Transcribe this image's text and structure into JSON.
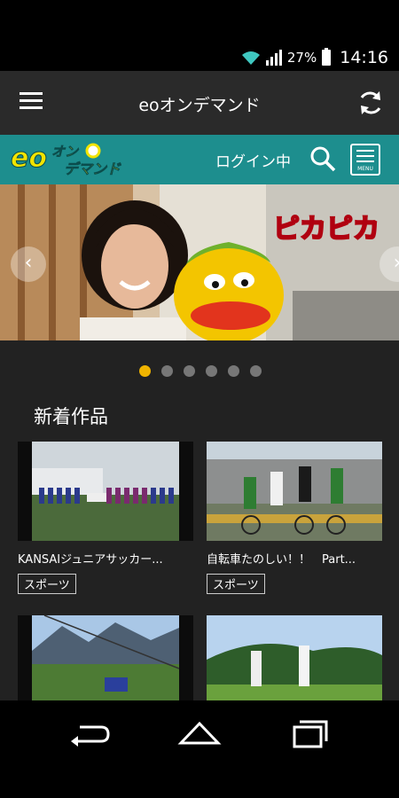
{
  "status_bar": {
    "battery": "27%",
    "time": "14:16",
    "icons": [
      "wifi-icon",
      "signal-icon",
      "battery-icon"
    ]
  },
  "action_bar": {
    "title": "eoオンデマンド",
    "icons": [
      "hamburger-menu-icon",
      "refresh-icon"
    ]
  },
  "brand_bar": {
    "logo_text": "eo",
    "logo_sub": "オン デマンド",
    "login_status": "ログイン中",
    "menu_label": "MENU",
    "accent_color": "#1d8e8e"
  },
  "hero": {
    "banner_text": "ピカピカ",
    "slides_total": 6,
    "active_slide": 1,
    "active_dot_color": "#f0b400"
  },
  "new_works": {
    "heading": "新着作品",
    "items": [
      {
        "title": "KANSAIジュニアサッカー...",
        "tag": "スポーツ"
      },
      {
        "title": "自転車たのしい！！　Part...",
        "tag": "スポーツ"
      },
      {
        "title": "",
        "tag": ""
      },
      {
        "title": "",
        "tag": ""
      }
    ]
  },
  "nav_bar": {
    "icons": [
      "back-icon",
      "home-icon",
      "recents-icon"
    ]
  }
}
